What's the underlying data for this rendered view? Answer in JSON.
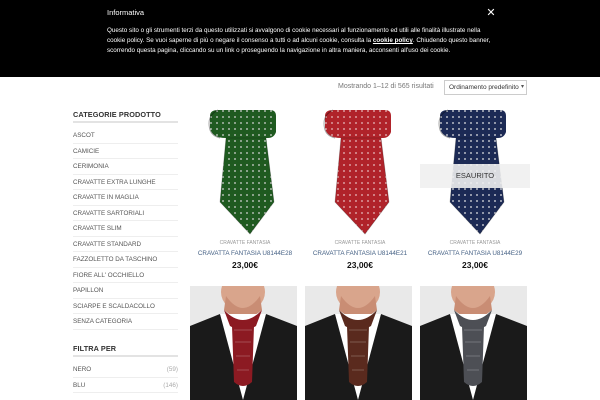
{
  "cookie": {
    "title": "Informativa",
    "text": "Questo sito o gli strumenti terzi da questo utilizzati si avvalgono di cookie necessari al funzionamento ed utili alle finalità illustrate nella cookie policy. Se vuoi saperne di più o negare il consenso a tutti o ad alcuni cookie, consulta la ",
    "link": "cookie policy",
    "text_after": ". Chiudendo questo banner, scorrendo questa pagina, cliccando su un link o proseguendo la navigazione in altra maniera, acconsenti all'uso dei cookie.",
    "close": "✕"
  },
  "results": {
    "count_text": "Mostrando 1–12 di 565 risultati",
    "sort_label": "Ordinamento predefinito"
  },
  "sidebar": {
    "categories_title": "CATEGORIE PRODOTTO",
    "categories": [
      "ASCOT",
      "CAMICIE",
      "CERIMONIA",
      "CRAVATTE EXTRA LUNGHE",
      "CRAVATTE IN MAGLIA",
      "CRAVATTE SARTORIALI",
      "CRAVATTE SLIM",
      "CRAVATTE STANDARD",
      "FAZZOLETTO DA TASCHINO",
      "FIORE ALL' OCCHIELLO",
      "PAPILLON",
      "SCIARPE E SCALDACOLLO",
      "SENZA CATEGORIA"
    ],
    "filter_title": "FILTRA PER",
    "filters": [
      {
        "label": "NERO",
        "count": "(59)"
      },
      {
        "label": "BLU",
        "count": "(146)"
      }
    ]
  },
  "products": [
    {
      "category": "CRAVATTE FANTASIA",
      "name": "CRAVATTA FANTASIA U8144E28",
      "price": "23,00€",
      "color": "#1f5a20",
      "dot": "#d6d6d6",
      "soldout": ""
    },
    {
      "category": "CRAVATTE FANTASIA",
      "name": "CRAVATTA FANTASIA U8144E21",
      "price": "23,00€",
      "color": "#b0232a",
      "dot": "#e8c0c0",
      "soldout": ""
    },
    {
      "category": "CRAVATTE FANTASIA",
      "name": "CRAVATTA FANTASIA U8144E29",
      "price": "23,00€",
      "color": "#1c2a55",
      "dot": "#e6e6e6",
      "soldout": "ESAURITO"
    }
  ],
  "ascots": [
    {
      "color": "#8c1a22"
    },
    {
      "color": "#5a2a1e"
    },
    {
      "color": "#4d4f55"
    }
  ],
  "swatch_colors": [
    "#4a2a22",
    "#8a6e3a",
    "#1d1d1d",
    "#b21e2a",
    "#f2d8d8",
    "#c9a62c",
    "#2a7fa3",
    "#e8d3b8"
  ]
}
